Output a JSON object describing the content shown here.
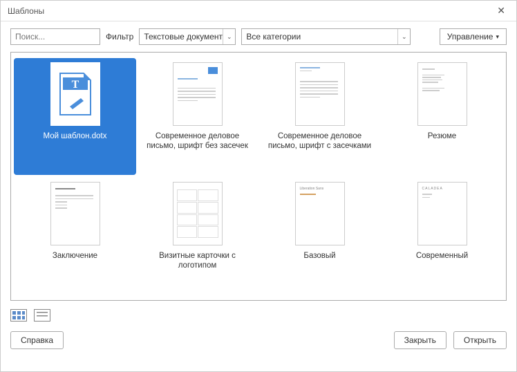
{
  "window": {
    "title": "Шаблоны"
  },
  "toolbar": {
    "search_placeholder": "Поиск...",
    "filter_label": "Фильтр",
    "filter_value": "Текстовые документы",
    "category_value": "Все категории",
    "manage_label": "Управление"
  },
  "templates": [
    {
      "label": "Мой шаблон.dotx",
      "selected": true,
      "kind": "user"
    },
    {
      "label": "Современное деловое письмо, шрифт без засечек",
      "selected": false,
      "kind": "letter-sans"
    },
    {
      "label": "Современное деловое письмо, шрифт с засечками",
      "selected": false,
      "kind": "letter-serif"
    },
    {
      "label": "Резюме",
      "selected": false,
      "kind": "resume"
    },
    {
      "label": "Заключение",
      "selected": false,
      "kind": "report"
    },
    {
      "label": "Визитные карточки с логотипом",
      "selected": false,
      "kind": "bizcard"
    },
    {
      "label": "Базовый",
      "selected": false,
      "kind": "default"
    },
    {
      "label": "Современный",
      "selected": false,
      "kind": "modern"
    }
  ],
  "footer": {
    "help_label": "Справка",
    "close_label": "Закрыть",
    "open_label": "Открыть"
  }
}
